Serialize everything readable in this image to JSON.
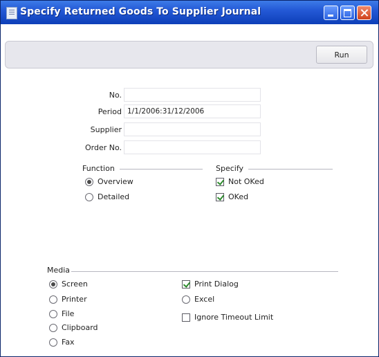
{
  "window": {
    "title": "Specify Returned Goods To Supplier Journal"
  },
  "toolbar": {
    "run_label": "Run"
  },
  "fields": {
    "no": {
      "label": "No.",
      "value": ""
    },
    "period": {
      "label": "Period",
      "value": "1/1/2006:31/12/2006"
    },
    "supplier": {
      "label": "Supplier",
      "value": ""
    },
    "order_no": {
      "label": "Order No.",
      "value": ""
    }
  },
  "function": {
    "title": "Function",
    "options": [
      {
        "label": "Overview",
        "selected": true
      },
      {
        "label": "Detailed",
        "selected": false
      }
    ]
  },
  "specify": {
    "title": "Specify",
    "options": [
      {
        "label": "Not OKed",
        "checked": true
      },
      {
        "label": "OKed",
        "checked": true
      }
    ]
  },
  "media": {
    "title": "Media",
    "options": [
      {
        "label": "Screen",
        "selected": true
      },
      {
        "label": "Printer",
        "selected": false
      },
      {
        "label": "File",
        "selected": false
      },
      {
        "label": "Clipboard",
        "selected": false
      },
      {
        "label": "Fax",
        "selected": false
      }
    ],
    "checks": [
      {
        "label": "Print Dialog",
        "checked": true
      },
      {
        "label": "Excel",
        "checked": false,
        "kind": "radio"
      },
      {
        "label": "Ignore Timeout Limit",
        "checked": false
      }
    ]
  }
}
